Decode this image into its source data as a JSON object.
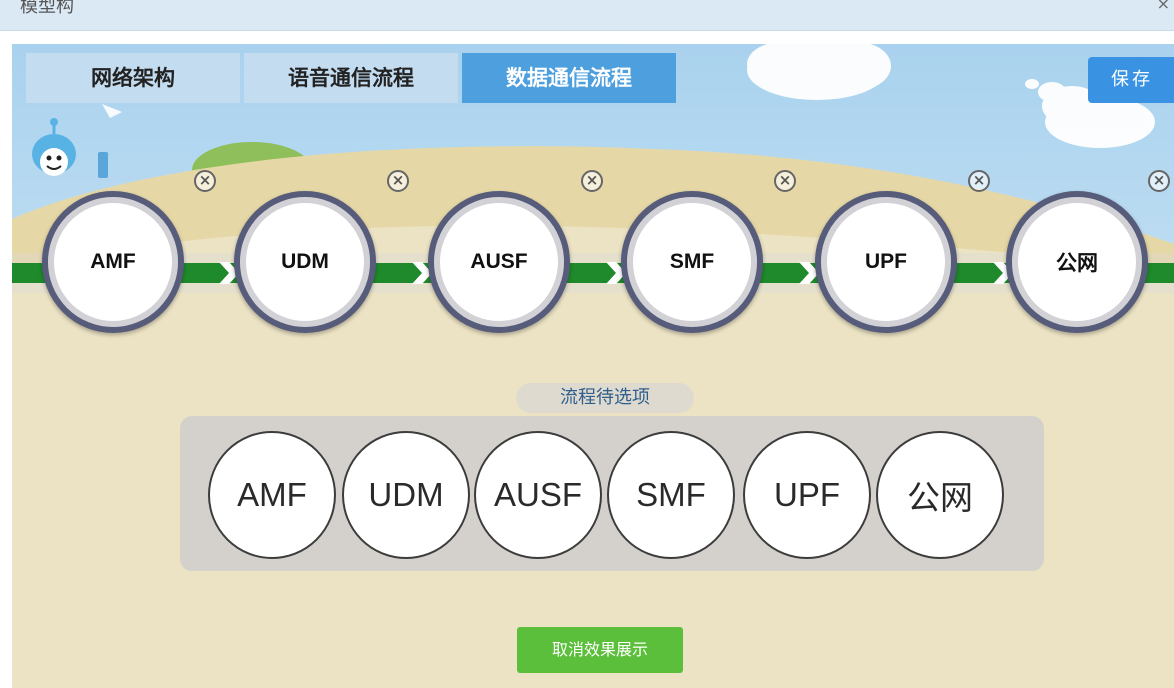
{
  "window": {
    "title": "模型构",
    "close_glyph": "×"
  },
  "tabs": [
    {
      "label": "网络架构",
      "active": false
    },
    {
      "label": "语音通信流程",
      "active": false
    },
    {
      "label": "数据通信流程",
      "active": true
    }
  ],
  "save_label": "保存",
  "flow": {
    "nodes": [
      "AMF",
      "UDM",
      "AUSF",
      "SMF",
      "UPF",
      "公网"
    ],
    "remove_glyph": "×",
    "arrow_color": "#1f8a2c",
    "node_border_color": "#575c7b"
  },
  "options": {
    "label": "流程待选项",
    "items": [
      "AMF",
      "UDM",
      "AUSF",
      "SMF",
      "UPF",
      "公网"
    ]
  },
  "cancel_label": "取消效果展示",
  "colors": {
    "tab_active": "#4e9fdd",
    "tab_inactive": "#c4dcef",
    "save_button": "#3a93e2",
    "cancel_button": "#5cbf3b",
    "sky": "#bcdcf0",
    "ground": "#ece3c4"
  }
}
